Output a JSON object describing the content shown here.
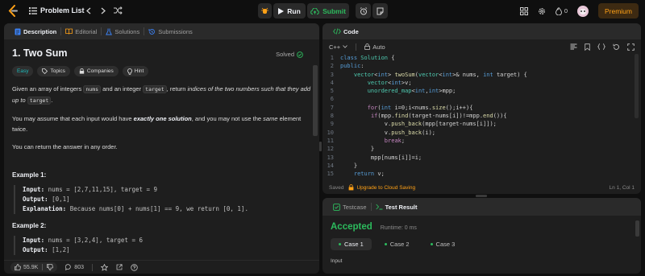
{
  "nav": {
    "problem_list": "Problem List",
    "run": "Run",
    "submit": "Submit",
    "streak": "0",
    "premium": "Premium"
  },
  "left_tabs": [
    "Description",
    "Editorial",
    "Solutions",
    "Submissions"
  ],
  "problem": {
    "title": "1. Two Sum",
    "status": "Solved",
    "difficulty": "Easy",
    "chips": [
      "Topics",
      "Companies",
      "Hint"
    ],
    "p1_a": "Given an array of integers ",
    "p1_code1": "nums",
    "p1_b": " and an integer ",
    "p1_code2": "target",
    "p1_c": ", return ",
    "p1_em": "indices of the two numbers such that they add up to",
    "p1_code3": "target",
    "p1_d": ".",
    "p2_a": "You may assume that each input would have ",
    "p2_strong": "exactly one solution",
    "p2_b": ", and you may not use the ",
    "p2_em": "same",
    "p2_c": " element twice.",
    "p3": "You can return the answer in any order.",
    "examples": [
      {
        "heading": "Example 1:",
        "input_label": "Input:",
        "input": " nums = [2,7,11,15], target = 9",
        "output_label": "Output:",
        "output": " [0,1]",
        "expl_label": "Explanation:",
        "expl": " Because nums[0] + nums[1] == 9, we return [0, 1]."
      },
      {
        "heading": "Example 2:",
        "input_label": "Input:",
        "input": " nums = [3,2,4], target = 6",
        "output_label": "Output:",
        "output": " [1,2]"
      }
    ]
  },
  "footer": {
    "likes": "55.9K",
    "comments": "803"
  },
  "code_panel": {
    "title": "Code",
    "language": "C++",
    "auto": "Auto",
    "saved": "Saved",
    "upgrade": "Upgrade to Cloud Saving",
    "cursor": "Ln 1, Col 1",
    "lines": [
      "class Solution {",
      "public:",
      "    vector<int> twoSum(vector<int>& nums, int target) {",
      "        vector<int>v;",
      "        unordered_map<int,int>mpp;",
      "",
      "        for(int i=0;i<nums.size();i++){",
      "         if(mpp.find(target-nums[i])!=mpp.end()){",
      "             v.push_back(mpp[target-nums[i]]);",
      "             v.push_back(i);",
      "             break;",
      "         }",
      "         mpp[nums[i]]=i;",
      "    }",
      "    return v;"
    ]
  },
  "tests": {
    "tab1": "Testcase",
    "tab2": "Test Result",
    "result": "Accepted",
    "runtime": "Runtime: 0 ms",
    "cases": [
      "Case 1",
      "Case 2",
      "Case 3"
    ],
    "input_label": "Input"
  },
  "colors": {
    "accent_green": "#2cbb5d",
    "premium_orange": "#ffa116",
    "easy_teal": "#1cbaba"
  }
}
